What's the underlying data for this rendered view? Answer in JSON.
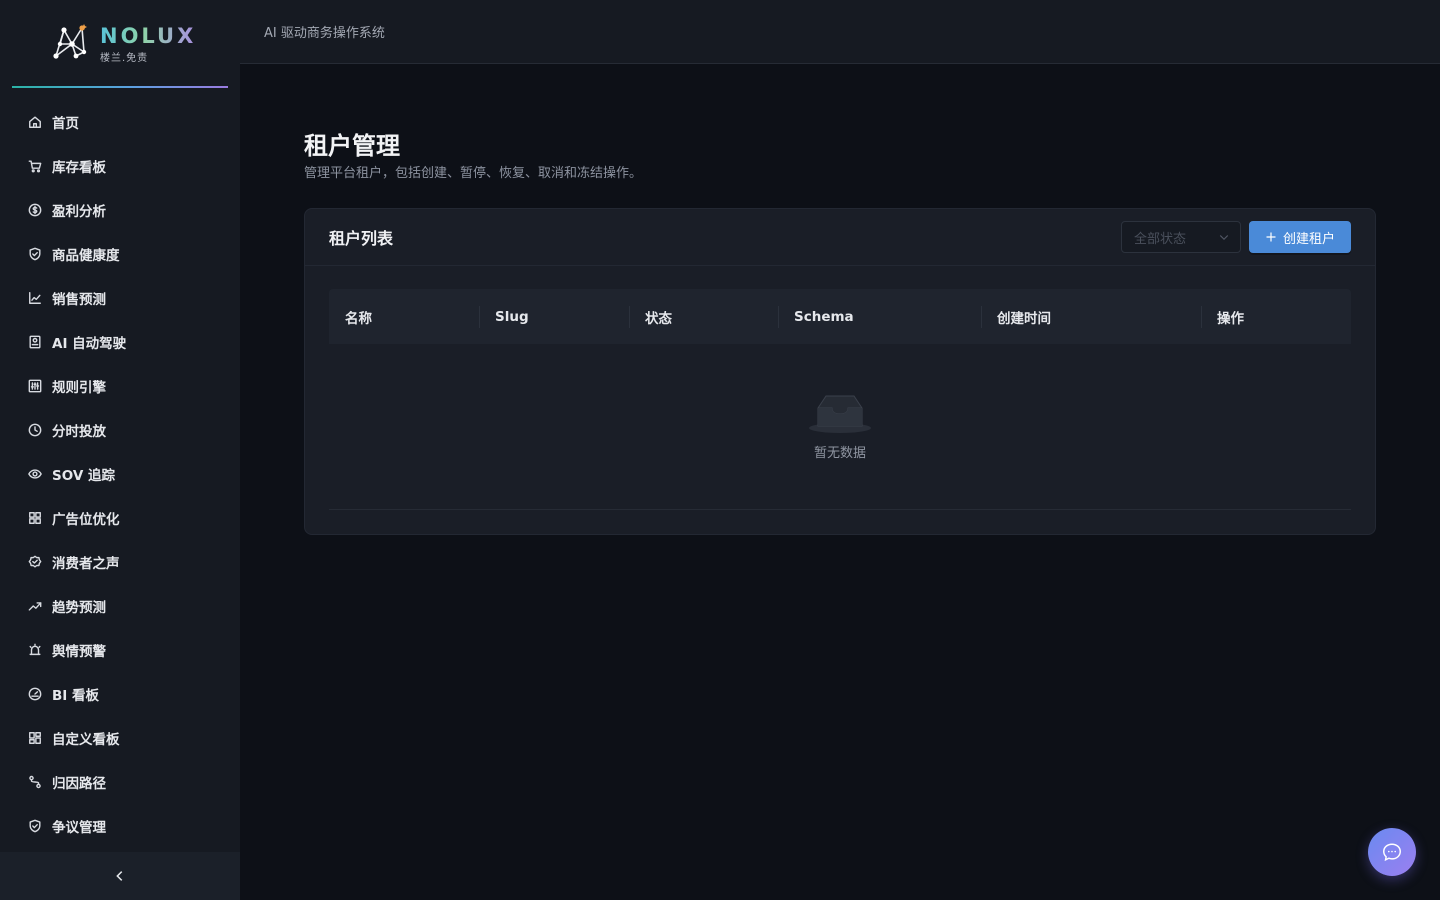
{
  "brand": {
    "name": "NOLUX",
    "subtitle": "楼兰.免责"
  },
  "header": {
    "title": "AI 驱动商务操作系统"
  },
  "sidebar": {
    "items": [
      {
        "label": "首页",
        "icon": "home-icon"
      },
      {
        "label": "库存看板",
        "icon": "cart-icon"
      },
      {
        "label": "盈利分析",
        "icon": "dollar-icon"
      },
      {
        "label": "商品健康度",
        "icon": "shield-check-icon"
      },
      {
        "label": "销售预测",
        "icon": "line-chart-icon"
      },
      {
        "label": "AI 自动驾驶",
        "icon": "bot-icon"
      },
      {
        "label": "规则引擎",
        "icon": "sliders-icon"
      },
      {
        "label": "分时投放",
        "icon": "clock-icon"
      },
      {
        "label": "SOV 追踪",
        "icon": "eye-icon"
      },
      {
        "label": "广告位优化",
        "icon": "grid-icon"
      },
      {
        "label": "消费者之声",
        "icon": "award-icon"
      },
      {
        "label": "趋势预测",
        "icon": "trending-up-icon"
      },
      {
        "label": "舆情预警",
        "icon": "alarm-icon"
      },
      {
        "label": "BI 看板",
        "icon": "gauge-icon"
      },
      {
        "label": "自定义看板",
        "icon": "layout-icon"
      },
      {
        "label": "归因路径",
        "icon": "route-icon"
      },
      {
        "label": "争议管理",
        "icon": "shield-icon"
      }
    ],
    "collapse_icon": "chevron-left-icon"
  },
  "page": {
    "title": "租户管理",
    "description": "管理平台租户，包括创建、暂停、恢复、取消和冻结操作。"
  },
  "card": {
    "title": "租户列表",
    "status_select": {
      "placeholder": "全部状态"
    },
    "create_button": "创建租户"
  },
  "table": {
    "columns": [
      "名称",
      "Slug",
      "状态",
      "Schema",
      "创建时间",
      "操作"
    ],
    "rows": [],
    "empty_text": "暂无数据"
  },
  "colors": {
    "accent": "#4a8ad8",
    "background": "#0d1017",
    "sidebar": "#161a22"
  }
}
